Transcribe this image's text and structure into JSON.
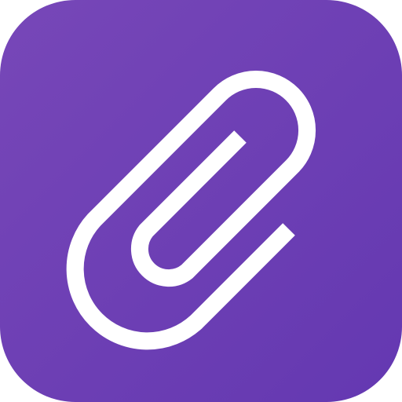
{
  "icon": {
    "name": "paperclip-icon",
    "background_gradient": [
      "#7747B8",
      "#6438B1"
    ],
    "glyph_color": "#FFFFFF"
  }
}
